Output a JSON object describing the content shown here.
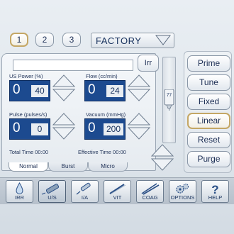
{
  "presets": {
    "items": [
      "1",
      "2",
      "3"
    ],
    "active_index": 0
  },
  "profile": {
    "value": "FACTORY"
  },
  "status_text": "",
  "irr_label": "Irr",
  "params": {
    "us_power": {
      "label": "US Power (%)",
      "current": "0",
      "limit": "40"
    },
    "flow": {
      "label": "Flow (cc/min)",
      "current": "0",
      "limit": "24"
    },
    "pulse": {
      "label": "Pulse (pulses/s)",
      "current": "0",
      "limit": "0"
    },
    "vacuum": {
      "label": "Vacuum (mmHg)",
      "current": "0",
      "limit": "200"
    }
  },
  "total_time": "Total Time 00:00",
  "effective_time": "Effective Time 00:00",
  "mode_tabs": [
    "Normal",
    "Burst",
    "Micro"
  ],
  "mode_tab_active": "Normal",
  "bottle_height": "77",
  "side_buttons": [
    "Prime",
    "Tune",
    "Fixed",
    "Linear",
    "Reset",
    "Purge"
  ],
  "side_active": "Linear",
  "nav": [
    {
      "label": "IRR",
      "icon": "irrigation-drop-icon"
    },
    {
      "label": "U/S",
      "icon": "ultrasound-handpiece-icon",
      "active": true
    },
    {
      "label": "I/A",
      "icon": "irrigation-aspiration-icon"
    },
    {
      "label": "VIT",
      "icon": "vitrectomy-cutter-icon"
    },
    {
      "label": "COAG",
      "icon": "coagulation-forceps-icon"
    },
    {
      "label": "OPTIONS",
      "icon": "gears-icon"
    },
    {
      "label": "HELP",
      "icon": "question-mark-icon"
    }
  ],
  "colors": {
    "value_box": "#1c4a8f",
    "active_outline": "#c4a765",
    "text": "#16305c"
  }
}
